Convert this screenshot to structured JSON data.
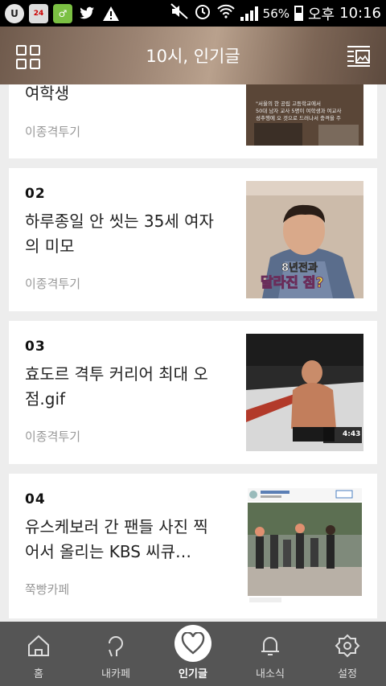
{
  "status": {
    "battery": "56%",
    "ampm": "오후",
    "time": "10:16",
    "icons": [
      "u-app-icon",
      "ytn-icon",
      "green-app-icon",
      "twitter-icon",
      "warning-icon",
      "mute-icon",
      "alarm-icon",
      "wifi-icon",
      "signal-icon",
      "battery-icon"
    ]
  },
  "header": {
    "title": "10시, 인기글"
  },
  "posts": [
    {
      "number": "",
      "title": "여학생",
      "category": "이종격투기"
    },
    {
      "number": "02",
      "title": "하루종일 안 씻는 35세 여자의 미모",
      "category": "이종격투기",
      "thumb_caption1": "8년전과",
      "thumb_caption2": "달라진 점?"
    },
    {
      "number": "03",
      "title": "효도르 격투 커리어 최대 오점.gif",
      "category": "이종격투기",
      "thumb_time": "4:43"
    },
    {
      "number": "04",
      "title": "유스케보러 간 팬들 사진 찍어서 올리는 KBS 씨큐…",
      "category": "쭉빵카페"
    }
  ],
  "tabs": [
    {
      "label": "홈",
      "icon": "home-icon"
    },
    {
      "label": "내카페",
      "icon": "my-cafe-icon"
    },
    {
      "label": "인기글",
      "icon": "heart-icon"
    },
    {
      "label": "내소식",
      "icon": "bell-icon"
    },
    {
      "label": "설정",
      "icon": "gear-icon"
    }
  ]
}
